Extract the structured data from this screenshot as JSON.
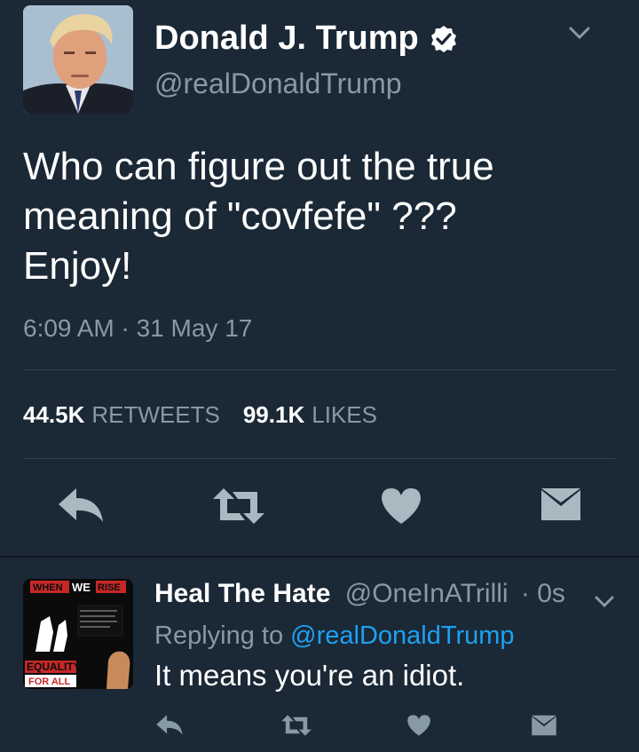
{
  "colors": {
    "background": "#1b2836",
    "text_primary": "#ffffff",
    "text_secondary": "#8899a6",
    "link": "#1da1f2",
    "divider": "#38444d"
  },
  "main_tweet": {
    "display_name": "Donald J. Trump",
    "verified": true,
    "handle": "@realDonaldTrump",
    "text_lines": [
      "Who can figure out the true",
      "meaning of \"covfefe\" ???",
      "Enjoy!"
    ],
    "timestamp": "6:09 AM · 31 May 17",
    "retweets_count": "44.5K",
    "retweets_label": "RETWEETS",
    "likes_count": "99.1K",
    "likes_label": "LIKES",
    "actions": [
      "reply-icon",
      "retweet-icon",
      "heart-icon",
      "dm-icon"
    ]
  },
  "reply_tweet": {
    "display_name": "Heal The Hate",
    "handle": "@OneInATrilli",
    "time": "· 0s",
    "replying_prefix": "Replying to",
    "replying_to": "@realDonaldTrump",
    "text": "It means you're an idiot.",
    "avatar_text": {
      "top_left": "WHEN",
      "top_mid": "WE",
      "top_right": "RISE",
      "bottom_1": "EQUALITY",
      "bottom_2": "FOR ALL"
    },
    "actions": [
      "reply-icon",
      "retweet-icon",
      "heart-icon",
      "dm-icon"
    ]
  }
}
